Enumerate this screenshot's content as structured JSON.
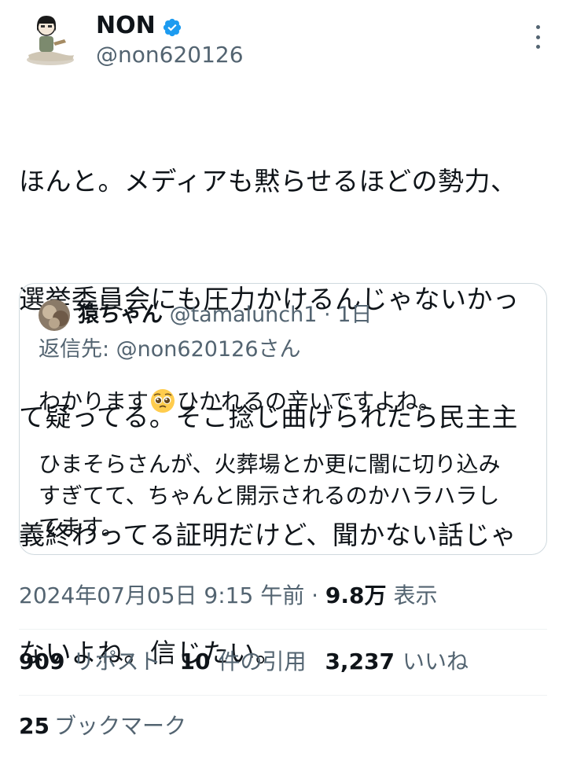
{
  "author": {
    "name": "NON",
    "handle": "@non620126",
    "verified": true
  },
  "tweet": {
    "lines": [
      "ほんと。メディアも黙らせるほどの勢力、",
      "選挙委員会にも圧力かけるんじゃないかっ",
      "て疑ってる。そこ捻じ曲げられたら民主主",
      "義終わってる証明だけど、聞かない話じゃ",
      "ないよね。信じたい。"
    ]
  },
  "quote": {
    "name": "猿ちゃん",
    "handle": "@tamalunch1",
    "separator": "·",
    "date": "1日",
    "reply_to": "返信先: @non620126さん",
    "line1_before": "わかります",
    "line1_emoji": "pleading-face",
    "line1_after": "ひかれるの辛いですよね。",
    "body_lines": [
      "ひまそらさんが、火葬場とか更に闇に切り込み",
      "すぎてて、ちゃんと開示されるのかハラハラし",
      "てます。"
    ]
  },
  "meta": {
    "timestamp": "2024年07月05日 9:15 午前",
    "separator": "·",
    "views_count": "9.8万",
    "views_label": "表示"
  },
  "stats": {
    "reposts_count": "909",
    "reposts_label": "リポスト",
    "quotes_count": "10",
    "quotes_label": "件の引用",
    "likes_count": "3,237",
    "likes_label": "いいね"
  },
  "bookmarks": {
    "count": "25",
    "label": "ブックマーク"
  },
  "colors": {
    "text": "#0f1419",
    "secondary": "#536471",
    "verified": "#1d9bf0",
    "border": "#cfd9de",
    "divider": "#eff3f4"
  }
}
